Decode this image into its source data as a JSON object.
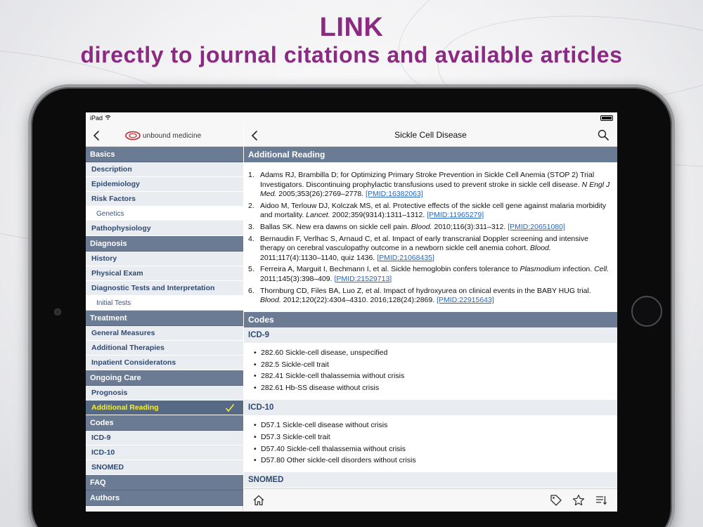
{
  "promo": {
    "headline": "LINK",
    "subheadline": "directly to journal citations and available articles",
    "color": "#8a2a82"
  },
  "statusbar": {
    "device": "iPad"
  },
  "left_pane": {
    "logo_text": "unbound medicine",
    "menu": [
      {
        "type": "section",
        "label": "Basics"
      },
      {
        "type": "item",
        "label": "Description"
      },
      {
        "type": "item",
        "label": "Epidemiology"
      },
      {
        "type": "item",
        "label": "Risk Factors"
      },
      {
        "type": "sub",
        "label": "Genetics"
      },
      {
        "type": "item",
        "label": "Pathophysiology"
      },
      {
        "type": "section",
        "label": "Diagnosis"
      },
      {
        "type": "item",
        "label": "History"
      },
      {
        "type": "item",
        "label": "Physical Exam"
      },
      {
        "type": "item",
        "label": "Diagnostic Tests and Interpretation"
      },
      {
        "type": "sub",
        "label": "Initial Tests"
      },
      {
        "type": "section",
        "label": "Treatment"
      },
      {
        "type": "item",
        "label": "General Measures"
      },
      {
        "type": "item",
        "label": "Additional Therapies"
      },
      {
        "type": "item",
        "label": "Inpatient Consideratons"
      },
      {
        "type": "section",
        "label": "Ongoing Care"
      },
      {
        "type": "item",
        "label": "Prognosis"
      },
      {
        "type": "active",
        "label": "Additional Reading"
      },
      {
        "type": "section",
        "label": "Codes"
      },
      {
        "type": "item",
        "label": "ICD-9"
      },
      {
        "type": "item",
        "label": "ICD-10"
      },
      {
        "type": "item",
        "label": "SNOMED"
      },
      {
        "type": "section",
        "label": "FAQ"
      },
      {
        "type": "section",
        "label": "Authors"
      }
    ],
    "active_color": "#f6ef3a"
  },
  "right_pane": {
    "title": "Sickle Cell Disease",
    "additional_reading_heading": "Additional Reading",
    "references": [
      {
        "num": "1.",
        "parts": [
          {
            "t": "Adams RJ, Brambilla D; for Optimizing Primary Stroke Prevention in Sickle Cell Anemia (STOP 2) Trial Investigators. Discontinuing prophylactic transfusions used to prevent stroke in sickle cell disease. "
          },
          {
            "t": "N Engl J Med.",
            "i": true
          },
          {
            "t": " 2005;353(26):2769–2778. "
          },
          {
            "t": "[PMID:16382063]",
            "link": true
          }
        ]
      },
      {
        "num": "2.",
        "parts": [
          {
            "t": "Aidoo M, Terlouw DJ, Kolczak MS, et al. Protective effects of the sickle cell gene against malaria morbidity and mortality. "
          },
          {
            "t": "Lancet.",
            "i": true
          },
          {
            "t": " 2002;359(9314):1311–1312. "
          },
          {
            "t": "[PMID:11965279]",
            "link": true
          }
        ]
      },
      {
        "num": "3.",
        "parts": [
          {
            "t": "Ballas SK. New era dawns on sickle cell pain. "
          },
          {
            "t": "Blood.",
            "i": true
          },
          {
            "t": " 2010;116(3):311–312. "
          },
          {
            "t": "[PMID:20651080]",
            "link": true
          }
        ]
      },
      {
        "num": "4.",
        "parts": [
          {
            "t": "Bernaudin F, Verlhac S, Arnaud C, et al. Impact of early transcranial Doppler screening and intensive therapy on cerebral vasculopathy outcome in a newborn sickle cell anemia cohort. "
          },
          {
            "t": "Blood.",
            "i": true
          },
          {
            "t": " 2011;117(4):1130–1140, quiz 1436. "
          },
          {
            "t": "[PMID:21068435]",
            "link": true
          }
        ]
      },
      {
        "num": "5.",
        "parts": [
          {
            "t": "Ferreira A, Marguit I, Bechmann I, et al. Sickle hemoglobin confers tolerance to "
          },
          {
            "t": "Plasmodium",
            "i": true
          },
          {
            "t": " infection. "
          },
          {
            "t": "Cell.",
            "i": true
          },
          {
            "t": " 2011;145(3):398–409. "
          },
          {
            "t": "[PMID:21529713]",
            "link": true
          }
        ]
      },
      {
        "num": "6.",
        "parts": [
          {
            "t": "Thornburg CD, Files BA, Luo Z, et al. Impact of hydroxyurea on clinical events in the BABY HUG trial. "
          },
          {
            "t": "Blood.",
            "i": true
          },
          {
            "t": " 2012;120(22):4304–4310. 2016;128(24):2869. "
          },
          {
            "t": "[PMID:22915643]",
            "link": true
          }
        ]
      }
    ],
    "codes_heading": "Codes",
    "code_groups": [
      {
        "heading": "ICD-9",
        "items": [
          "282.60 Sickle-cell disease, unspecified",
          "282.5 Sickle-cell trait",
          "282.41 Sickle-cell thalassemia without crisis",
          "282.61 Hb-SS disease without crisis"
        ]
      },
      {
        "heading": "ICD-10",
        "items": [
          "D57.1 Sickle-cell disease without crisis",
          "D57.3 Sickle-cell trait",
          "D57.40 Sickle-cell thalassemia without crisis",
          "D57.80 Other sickle-cell disorders without crisis"
        ]
      },
      {
        "heading": "SNOMED",
        "items": []
      }
    ],
    "link_color": "#2367c3",
    "section_color": "#6b7b93"
  },
  "icons": {
    "toolbar": [
      "home-icon",
      "tag-icon",
      "star-icon",
      "list-icon"
    ],
    "nav": [
      "back-icon",
      "search-icon",
      "wifi-icon",
      "battery-icon",
      "checkmark-icon"
    ]
  }
}
